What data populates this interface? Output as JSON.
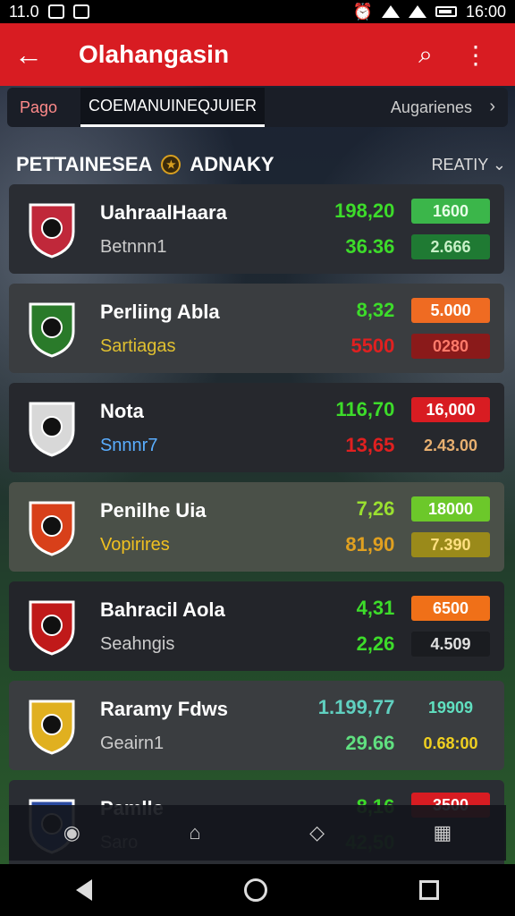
{
  "status": {
    "time_left": "11.0",
    "time_right": "16:00"
  },
  "appbar": {
    "title": "Olahangasin"
  },
  "tabs": [
    {
      "label": "Pago"
    },
    {
      "label": "COEMANUINEQJUIER"
    },
    {
      "label": "Augarienes"
    }
  ],
  "section": {
    "title": "PETTAINESEA",
    "title2": "ADNAKY",
    "filter": "REATIY ⌄"
  },
  "rows": [
    {
      "name": "UahraalHaara",
      "sub": "Betnnn1",
      "v1": "198,20",
      "v2": "36.36",
      "o1": "1600",
      "o2": "2.666",
      "sub_color": "#cccccc",
      "v_color": "#3ddc2a",
      "v2_color": "#3ddc2a",
      "pill1_bg": "#3bb64a",
      "pill2_bg": "#1f7a33",
      "pill1_color": "#e8ffe8",
      "pill2_color": "#c8f0c8",
      "bg": "#2a2d33"
    },
    {
      "name": "Perliing Abla",
      "sub": "Sartiagas",
      "v1": "8,32",
      "v2": "5500",
      "o1": "5.000",
      "o2": "0280",
      "sub_color": "#e0c030",
      "v_color": "#3ddc2a",
      "v2_color": "#e02020",
      "pill1_bg": "#ef6b22",
      "pill2_bg": "#8a1a1a",
      "pill1_color": "#ffffff",
      "pill2_color": "#ff7a6a",
      "bg": "#3a3d40"
    },
    {
      "name": "Nota",
      "sub": "Snnnr7",
      "v1": "116,70",
      "v2": "13,65",
      "o1": "16,000",
      "o2": "2.43.00",
      "sub_color": "#5aaeff",
      "v_color": "#3ddc2a",
      "v2_color": "#e02020",
      "pill1_bg": "#d81c22",
      "pill2_bg": "transparent",
      "pill1_color": "#ffffff",
      "pill2_color": "#e8b070",
      "bg": "#26282d"
    },
    {
      "name": "Penilhe Uia",
      "sub": "Vopirires",
      "v1": "7,26",
      "v2": "81,90",
      "o1": "18000",
      "o2": "7.390",
      "sub_color": "#f0c020",
      "v_color": "#9ae030",
      "v2_color": "#e0a020",
      "pill1_bg": "#6cc82a",
      "pill2_bg": "#9a8a1a",
      "pill1_color": "#ffffff",
      "pill2_color": "#ffe080",
      "bg": "#4a5048"
    },
    {
      "name": "Bahracil Aola",
      "sub": "Seahngis",
      "v1": "4,31",
      "v2": "2,26",
      "o1": "6500",
      "o2": "4.509",
      "sub_color": "#cccccc",
      "v_color": "#3ddc2a",
      "v2_color": "#3ddc2a",
      "pill1_bg": "#f07018",
      "pill2_bg": "#1a1c20",
      "pill1_color": "#ffffff",
      "pill2_color": "#e0e0e0",
      "bg": "#23252a"
    },
    {
      "name": "Raramy Fdws",
      "sub": "Geairn1",
      "v1": "1.199,77",
      "v2": "29.66",
      "o1": "19909",
      "o2": "0.68:00",
      "sub_color": "#cccccc",
      "v_color": "#60d0c0",
      "v2_color": "#60e080",
      "pill1_bg": "transparent",
      "pill2_bg": "transparent",
      "pill1_color": "#60e0c0",
      "pill2_color": "#f0d020",
      "bg": "#3a3d40"
    },
    {
      "name": "Pamlle",
      "sub": "Saro",
      "v1": "8,16",
      "v2": "42,50",
      "o1": "3500",
      "o2": "",
      "sub_color": "#aaaaaa",
      "v_color": "#3ddc2a",
      "v2_color": "#2a8a2a",
      "pill1_bg": "#d81c22",
      "pill2_bg": "transparent",
      "pill1_color": "#ffffff",
      "pill2_color": "#cccccc",
      "bg": "#2a2d33"
    }
  ],
  "colors": {
    "brand_red": "#d81c22"
  }
}
